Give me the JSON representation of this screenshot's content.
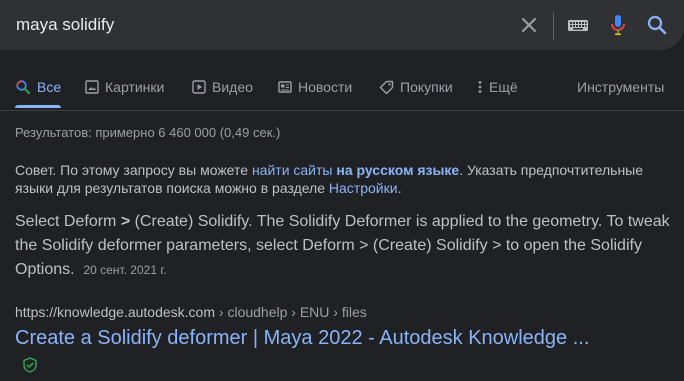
{
  "search": {
    "query": "maya solidify"
  },
  "tabs": [
    {
      "label": "Все",
      "icon": "search-icon",
      "active": true
    },
    {
      "label": "Картинки",
      "icon": "image-icon"
    },
    {
      "label": "Видео",
      "icon": "video-icon"
    },
    {
      "label": "Новости",
      "icon": "news-icon"
    },
    {
      "label": "Покупки",
      "icon": "tag-icon"
    },
    {
      "label": "Ещё",
      "icon": "more-vert-icon"
    }
  ],
  "tools_label": "Инструменты",
  "stats": "Результатов: примерно 6 460 000 (0,49 сек.)",
  "tip": {
    "part1": "Совет. По этому запросу вы можете ",
    "link1": "найти сайты",
    "space": " ",
    "link2": "на русском языке",
    "part2": ". Указать предпочтительные языки для результатов поиска можно в разделе ",
    "link3": "Настройки",
    "part3": "."
  },
  "snippet": {
    "part1": "Select Deform ",
    "gt": ">",
    "part2": " (Create) Solidify. The Solidify Deformer is applied to the geometry. To tweak the Solidify deformer parameters, select Deform > (Create) Solidify > to open the Solidify Options.",
    "date": "20 сент. 2021 г."
  },
  "result": {
    "url_domain": "https://knowledge.autodesk.com",
    "url_path": " › cloudhelp › ENU › files",
    "title": "Create a Solidify deformer | Maya 2022 - Autodesk Knowledge ..."
  },
  "colors": {
    "background": "#202124",
    "searchbar": "#303134",
    "link": "#8ab4f8",
    "text": "#bdc1c6",
    "muted": "#9aa0a6",
    "verified": "#34a853"
  }
}
